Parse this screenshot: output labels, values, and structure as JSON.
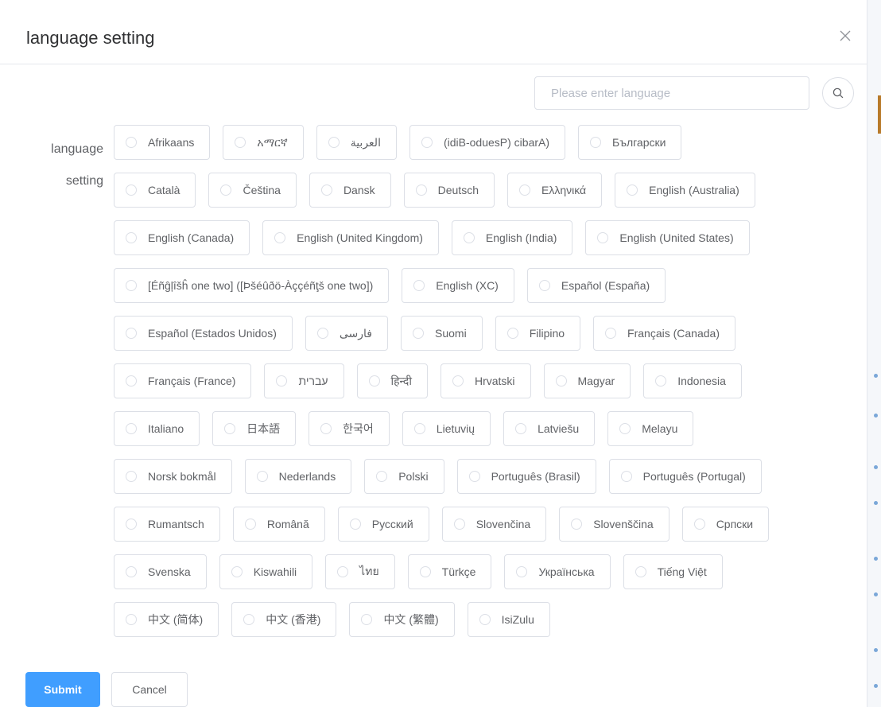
{
  "dialog": {
    "title": "language setting",
    "close_icon": "close-icon"
  },
  "search": {
    "placeholder": "Please enter language",
    "value": "",
    "icon": "search-icon"
  },
  "form": {
    "label": "language setting",
    "language_rows": [
      [
        "Afrikaans",
        "አማርኛ",
        "العربية",
        "(idiB-oduesP) cibarA)",
        "Български"
      ],
      [
        "Català",
        "Čeština",
        "Dansk",
        "Deutsch",
        "Ελληνικά",
        "English (Australia)"
      ],
      [
        "English (Canada)",
        "English (United Kingdom)",
        "English (India)",
        "English (United States)"
      ],
      [
        "[Éñĝļîšĥ one two] ([Þšéûðö-Àççéñţš one two])",
        "English (XC)",
        "Español (España)"
      ],
      [
        "Español (Estados Unidos)",
        "فارسی",
        "Suomi",
        "Filipino",
        "Français (Canada)"
      ],
      [
        "Français (France)",
        "עברית",
        "हिन्दी",
        "Hrvatski",
        "Magyar",
        "Indonesia"
      ],
      [
        "Italiano",
        "日本語",
        "한국어",
        "Lietuvių",
        "Latviešu",
        "Melayu"
      ],
      [
        "Norsk bokmål",
        "Nederlands",
        "Polski",
        "Português (Brasil)",
        "Português (Portugal)"
      ],
      [
        "Rumantsch",
        "Română",
        "Русский",
        "Slovenčina",
        "Slovenščina",
        "Српски"
      ],
      [
        "Svenska",
        "Kiswahili",
        "ไทย",
        "Türkçe",
        "Українська",
        "Tiếng Việt"
      ],
      [
        "中文 (简体)",
        "中文 (香港)",
        "中文 (繁體)",
        "IsiZulu"
      ]
    ]
  },
  "footer": {
    "submit_label": "Submit",
    "cancel_label": "Cancel"
  },
  "colors": {
    "primary": "#409eff",
    "border": "#dcdfe6",
    "text": "#606266",
    "title": "#303133"
  }
}
